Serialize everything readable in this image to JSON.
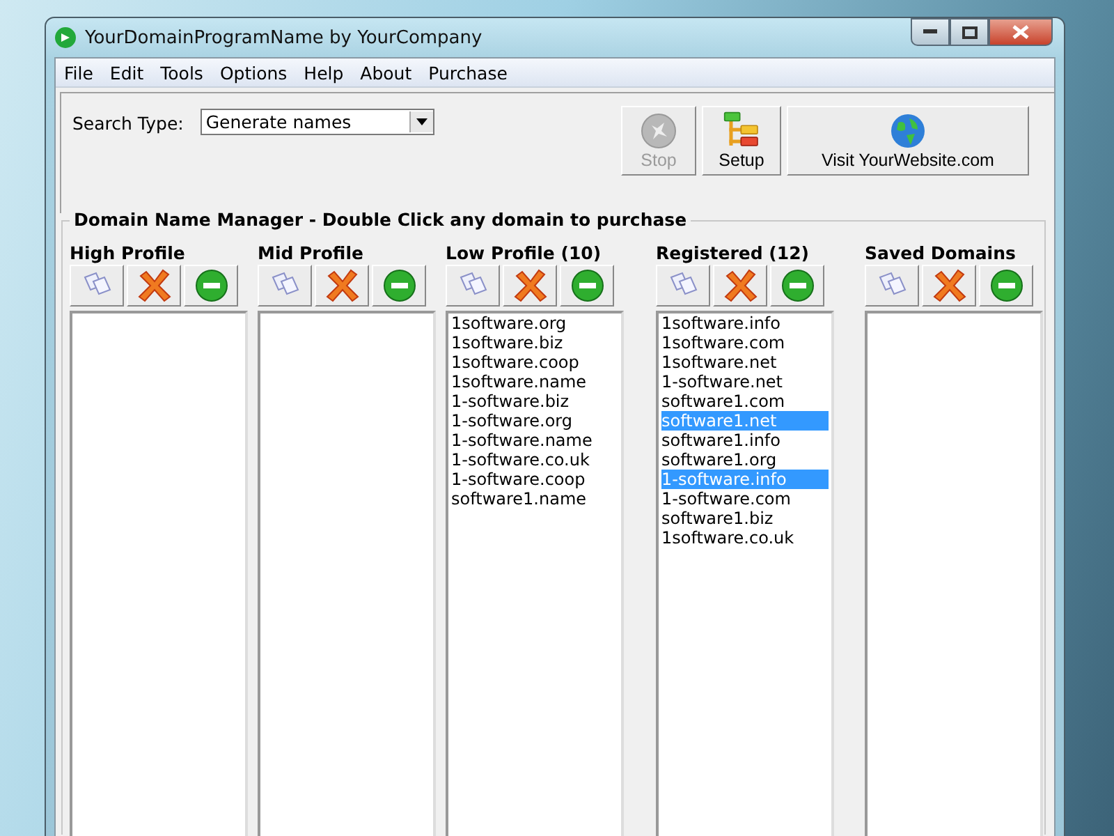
{
  "window": {
    "title": "YourDomainProgramName by YourCompany"
  },
  "menu": [
    "File",
    "Edit",
    "Tools",
    "Options",
    "Help",
    "About",
    "Purchase"
  ],
  "search_type": {
    "label": "Search Type:",
    "value": "Generate names"
  },
  "toolbar": [
    {
      "kind": "stop",
      "label": "Stop",
      "disabled": true
    },
    {
      "kind": "setup",
      "label": "Setup",
      "disabled": false
    },
    {
      "kind": "website",
      "label": "Visit YourWebsite.com",
      "disabled": false
    }
  ],
  "manager": {
    "title": "Domain Name Manager - Double Click any domain to purchase",
    "columns": [
      {
        "title": "High Profile"
      },
      {
        "title": "Mid Profile"
      },
      {
        "title": "Low Profile (10)",
        "items": [
          {
            "name": "1software.org",
            "selected": false
          },
          {
            "name": "1software.biz",
            "selected": false
          },
          {
            "name": "1software.coop",
            "selected": false
          },
          {
            "name": "1software.name",
            "selected": false
          },
          {
            "name": "1-software.biz",
            "selected": false
          },
          {
            "name": "1-software.org",
            "selected": false
          },
          {
            "name": "1-software.name",
            "selected": false
          },
          {
            "name": "1-software.co.uk",
            "selected": false
          },
          {
            "name": "1-software.coop",
            "selected": false
          },
          {
            "name": "software1.name",
            "selected": false
          }
        ]
      },
      {
        "title": "Registered (12)",
        "items": [
          {
            "name": "1software.info",
            "selected": false
          },
          {
            "name": "1software.com",
            "selected": false
          },
          {
            "name": "1software.net",
            "selected": false
          },
          {
            "name": "1-software.net",
            "selected": false
          },
          {
            "name": "software1.com",
            "selected": false
          },
          {
            "name": "software1.net",
            "selected": true
          },
          {
            "name": "software1.info",
            "selected": false
          },
          {
            "name": "software1.org",
            "selected": false
          },
          {
            "name": "1-software.info",
            "selected": true
          },
          {
            "name": "1-software.com",
            "selected": false
          },
          {
            "name": "software1.biz",
            "selected": false
          },
          {
            "name": "1software.co.uk",
            "selected": false
          }
        ]
      },
      {
        "title": "Saved Domains"
      }
    ]
  }
}
